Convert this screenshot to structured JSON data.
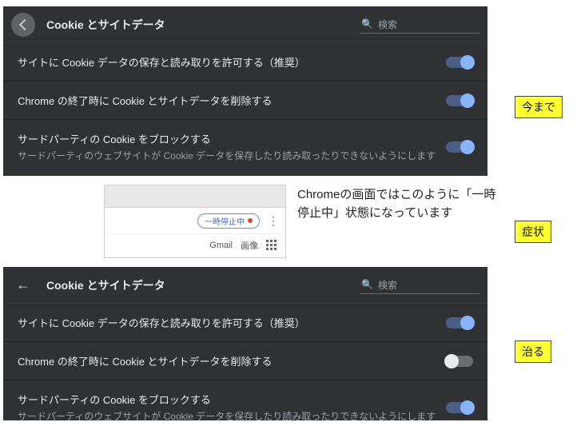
{
  "panel_top": {
    "title": "Cookie とサイトデータ",
    "search_placeholder": "検索",
    "rows": [
      {
        "title": "サイトに Cookie データの保存と読み取りを許可する（推奨）",
        "sub": "",
        "on": true
      },
      {
        "title": "Chrome の終了時に Cookie とサイトデータを削除する",
        "sub": "",
        "on": true
      },
      {
        "title": "サードパーティの Cookie をブロックする",
        "sub": "サードパーティのウェブサイトが Cookie データを保存したり読み取ったりできないようにします",
        "on": true
      }
    ]
  },
  "panel_bot": {
    "title": "Cookie とサイトデータ",
    "search_placeholder": "検索",
    "rows": [
      {
        "title": "サイトに Cookie データの保存と読み取りを許可する（推奨）",
        "sub": "",
        "on": true
      },
      {
        "title": "Chrome の終了時に Cookie とサイトデータを削除する",
        "sub": "",
        "on": false
      },
      {
        "title": "サードパーティの Cookie をブロックする",
        "sub": "サードパーティのウェブサイトが Cookie データを保存したり読み取ったりできないようにします",
        "on": true
      }
    ]
  },
  "card": {
    "pill_text": "一時停止中",
    "link_gmail": "Gmail",
    "link_images": "画像"
  },
  "caption": "Chromeの画面ではこのように「一時停止中」状態になっています",
  "tags": {
    "t1": "今まで",
    "t2": "症状",
    "t3": "治る"
  }
}
